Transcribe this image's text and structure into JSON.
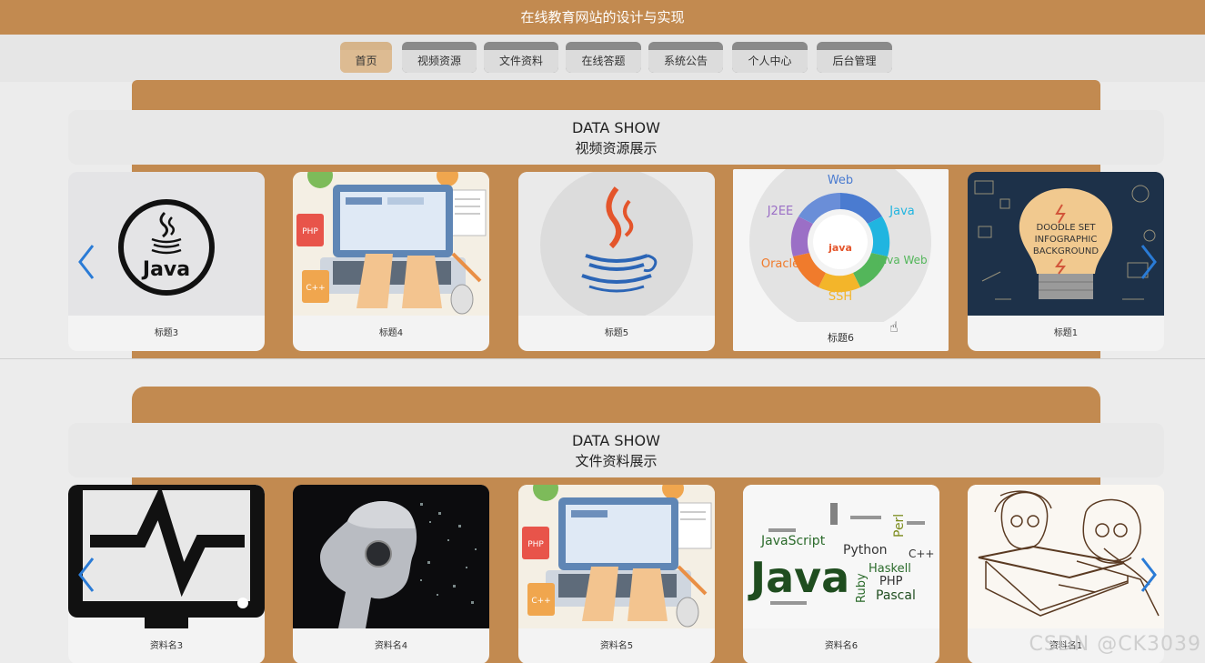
{
  "header": {
    "title": "在线教育网站的设计与实现"
  },
  "nav": {
    "items": [
      {
        "label": "首页",
        "active": true
      },
      {
        "label": "视频资源"
      },
      {
        "label": "文件资料"
      },
      {
        "label": "在线答题"
      },
      {
        "label": "系统公告"
      },
      {
        "label": "个人中心"
      },
      {
        "label": "后台管理"
      }
    ]
  },
  "videos": {
    "heading_en": "DATA SHOW",
    "heading_cn": "视频资源展示",
    "cards": [
      {
        "caption": "标题3",
        "image": "java-logo-circle",
        "logo_text": "Java"
      },
      {
        "caption": "标题4",
        "image": "laptop-typing-illustration",
        "badges": [
          "PHP",
          "C++"
        ]
      },
      {
        "caption": "标题5",
        "image": "java-coffee-cup"
      },
      {
        "caption": "标题6",
        "image": "java-technology-wheel",
        "labels": [
          "Web",
          "Java",
          "Java Web",
          "SSH",
          "Oracle",
          "J2EE",
          "java"
        ]
      },
      {
        "caption": "标题1",
        "image": "doodle-lightbulb-infographic",
        "labels": [
          "DOODLE SET",
          "INFOGRAPHIC",
          "BACKGROUND"
        ]
      }
    ]
  },
  "files": {
    "heading_en": "DATA SHOW",
    "heading_cn": "文件资料展示",
    "cards": [
      {
        "caption": "资料名3",
        "image": "monitor-pulse-icon"
      },
      {
        "caption": "资料名4",
        "image": "robot-head-particles"
      },
      {
        "caption": "资料名5",
        "image": "laptop-typing-illustration",
        "badges": [
          "PHP",
          "C++"
        ]
      },
      {
        "caption": "资料名6",
        "image": "programming-word-cloud",
        "labels": [
          "Java",
          "JavaScript",
          "Python",
          "Haskell",
          "PHP",
          "Pascal",
          "Ruby",
          "Perl",
          "C++"
        ]
      },
      {
        "caption": "资料名1",
        "image": "sketch-people-laptop"
      }
    ]
  },
  "watermark": "CSDN @CK3039",
  "colors": {
    "brand": "#c28a50",
    "nav_active": "#d6b48a",
    "arrow": "#2a7bd6"
  }
}
